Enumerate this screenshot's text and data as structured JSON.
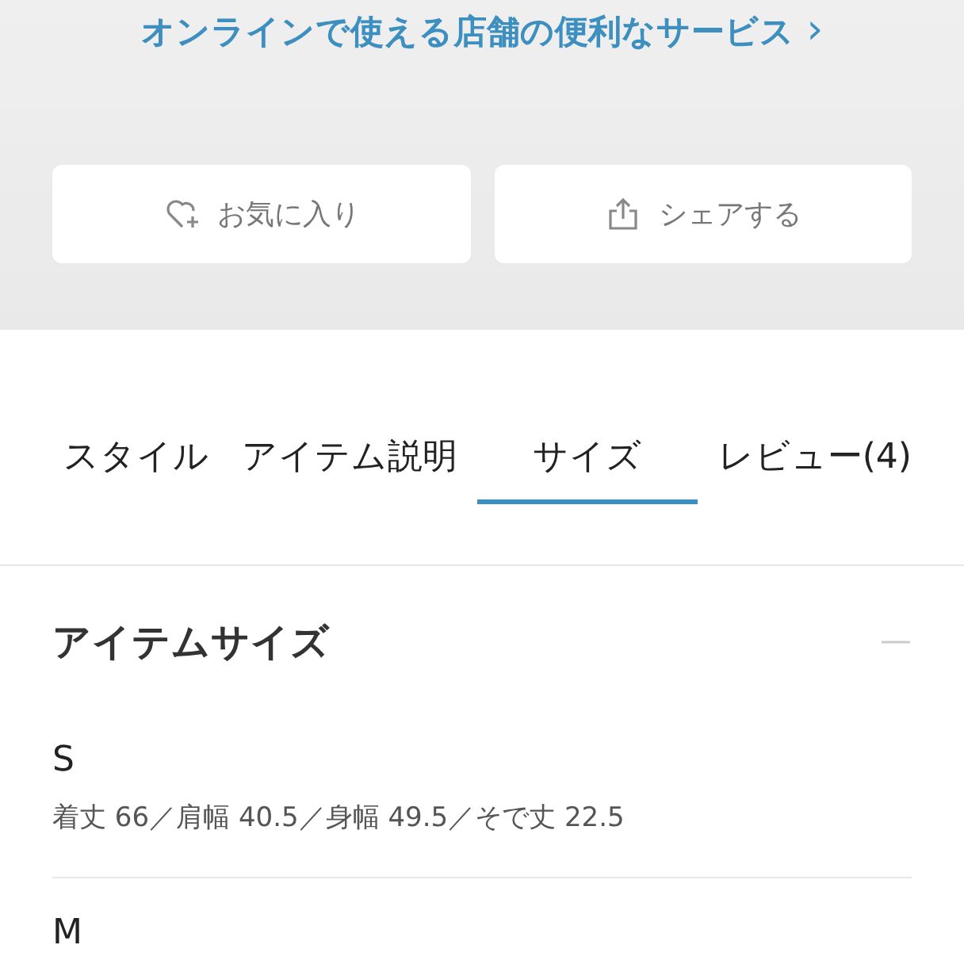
{
  "service_link": {
    "label": "オンラインで使える店舗の便利なサービス",
    "chevron": "›"
  },
  "actions": [
    {
      "kind": "favorite",
      "label": "お気に入り"
    },
    {
      "kind": "share",
      "label": "シェアする"
    }
  ],
  "tabs": [
    {
      "label": "スタイル",
      "selected": false
    },
    {
      "label": "アイテム説明",
      "selected": false
    },
    {
      "label": "サイズ",
      "selected": true
    },
    {
      "label": "レビュー(4)",
      "selected": false
    }
  ],
  "section": {
    "title": "アイテムサイズ",
    "expanded": true,
    "sizes": [
      {
        "name": "S",
        "measurements": "着丈 66／肩幅 40.5／身幅 49.5／そで丈 22.5"
      },
      {
        "name": "M"
      }
    ]
  }
}
